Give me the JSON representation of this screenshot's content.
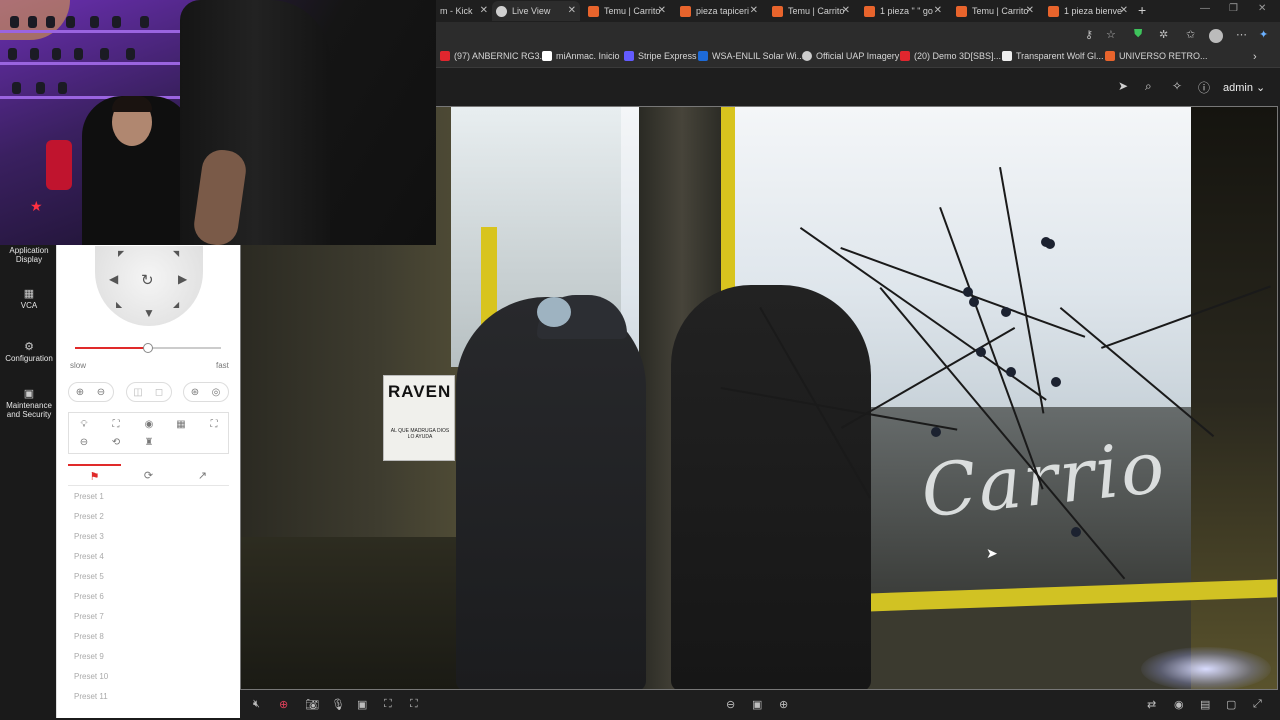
{
  "browser": {
    "tabs": [
      {
        "label": "m - Kick",
        "favicon": "kick"
      },
      {
        "label": "Live View",
        "favicon": "github"
      },
      {
        "label": "Temu | Carrito",
        "favicon": "temu"
      },
      {
        "label": "pieza tapiceri",
        "favicon": "temu"
      },
      {
        "label": "Temu | Carrito",
        "favicon": "temu"
      },
      {
        "label": "1 pieza \" \" go",
        "favicon": "temu"
      },
      {
        "label": "Temu | Carrito",
        "favicon": "temu"
      },
      {
        "label": "1 pieza bienve",
        "favicon": "temu"
      }
    ],
    "new_tab": "+",
    "bookmarks": [
      {
        "label": "(97) ANBERNIC RG3...",
        "color": "#e0262e"
      },
      {
        "label": "miAnmac. Inicio",
        "color": "#ffffff"
      },
      {
        "label": "Stripe Express",
        "color": "#635bff"
      },
      {
        "label": "WSA-ENLIL Solar Wi...",
        "color": "#1d6ad8"
      },
      {
        "label": "Official UAP Imagery",
        "color": "#cccccc"
      },
      {
        "label": "(20) Demo 3D[SBS]...",
        "color": "#e0262e"
      },
      {
        "label": "Transparent Wolf Gl...",
        "color": "#eeeeee"
      },
      {
        "label": "UNIVERSO RETRO...",
        "color": "#e8642c"
      }
    ]
  },
  "app": {
    "user": "admin",
    "nav": [
      {
        "label": "Application Display",
        "icon": "display-icon"
      },
      {
        "label": "VCA",
        "icon": "vca-icon"
      },
      {
        "label": "Configuration",
        "icon": "gear-icon"
      },
      {
        "label": "Maintenance and Security",
        "icon": "maintenance-icon"
      }
    ],
    "ptz": {
      "speed_slow": "slow",
      "speed_fast": "fast",
      "speed_level": 0.5,
      "presets": [
        "Preset 1",
        "Preset 2",
        "Preset 3",
        "Preset 4",
        "Preset 5",
        "Preset 6",
        "Preset 7",
        "Preset 8",
        "Preset 9",
        "Preset 10",
        "Preset 11"
      ]
    }
  },
  "video": {
    "sign_text": "RAVEN",
    "sign_sub": "AL QUE MADRUGA DIOS LO AYUDA",
    "script_text": "Carrio"
  },
  "colors": {
    "accent": "#e02a2a",
    "temu": "#e8642c"
  }
}
